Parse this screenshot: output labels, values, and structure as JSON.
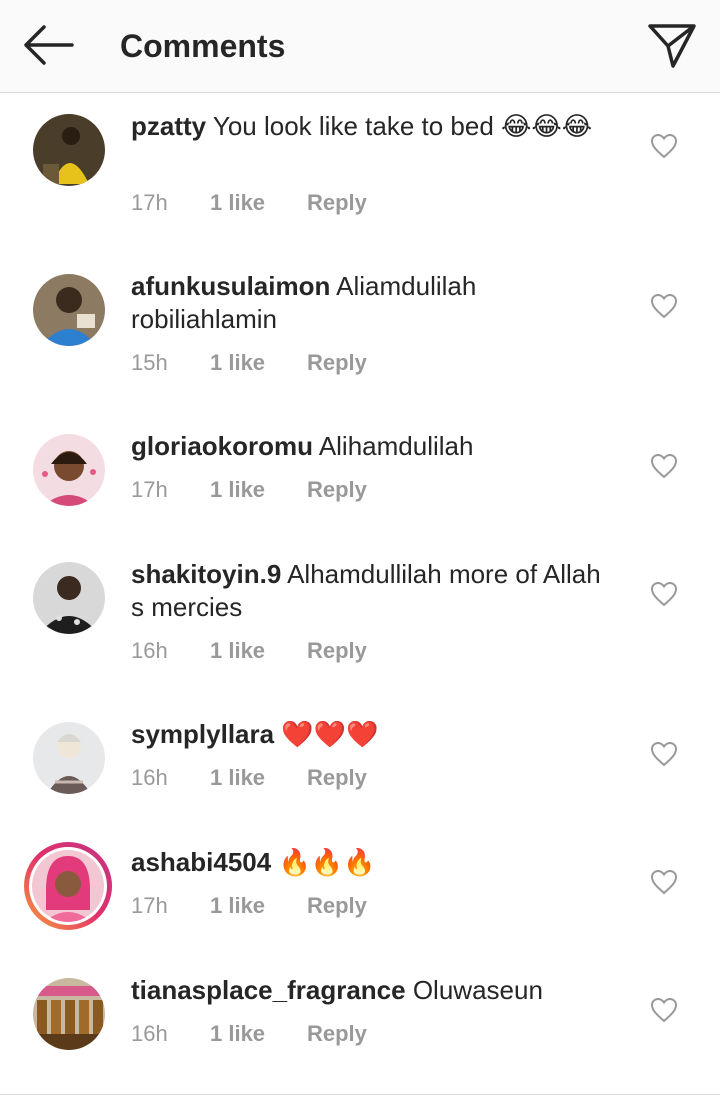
{
  "header": {
    "title": "Comments",
    "back_icon": "arrow-left-icon",
    "send_icon": "paper-plane-icon"
  },
  "comments": [
    {
      "username": "pzatty",
      "text": "You look like take to bed",
      "emoji": "😂😂😂",
      "time": "17h",
      "likes": "1 like",
      "reply": "Reply"
    },
    {
      "username": "afunkusulaimon",
      "text": "Aliamdulilah robiliahlamin",
      "emoji": "",
      "time": "15h",
      "likes": "1 like",
      "reply": "Reply"
    },
    {
      "username": "gloriaokoromu",
      "text": "Alihamdulilah",
      "emoji": "",
      "time": "17h",
      "likes": "1 like",
      "reply": "Reply"
    },
    {
      "username": "shakitoyin.9",
      "text": "Alhamdullilah more of Allah s mercies",
      "emoji": "",
      "time": "16h",
      "likes": "1 like",
      "reply": "Reply"
    },
    {
      "username": "symplyllara",
      "text": "",
      "emoji": "❤️❤️❤️",
      "time": "16h",
      "likes": "1 like",
      "reply": "Reply"
    },
    {
      "username": "ashabi4504",
      "text": "",
      "emoji": "🔥🔥🔥",
      "time": "17h",
      "likes": "1 like",
      "reply": "Reply"
    },
    {
      "username": "tianasplace_fragrance",
      "text": "Oluwaseun",
      "emoji": "",
      "time": "16h",
      "likes": "1 like",
      "reply": "Reply"
    }
  ],
  "colors": {
    "text": "#262626",
    "meta": "#999999",
    "header_bg": "#fafafa",
    "story_ring": "#e1306c"
  }
}
